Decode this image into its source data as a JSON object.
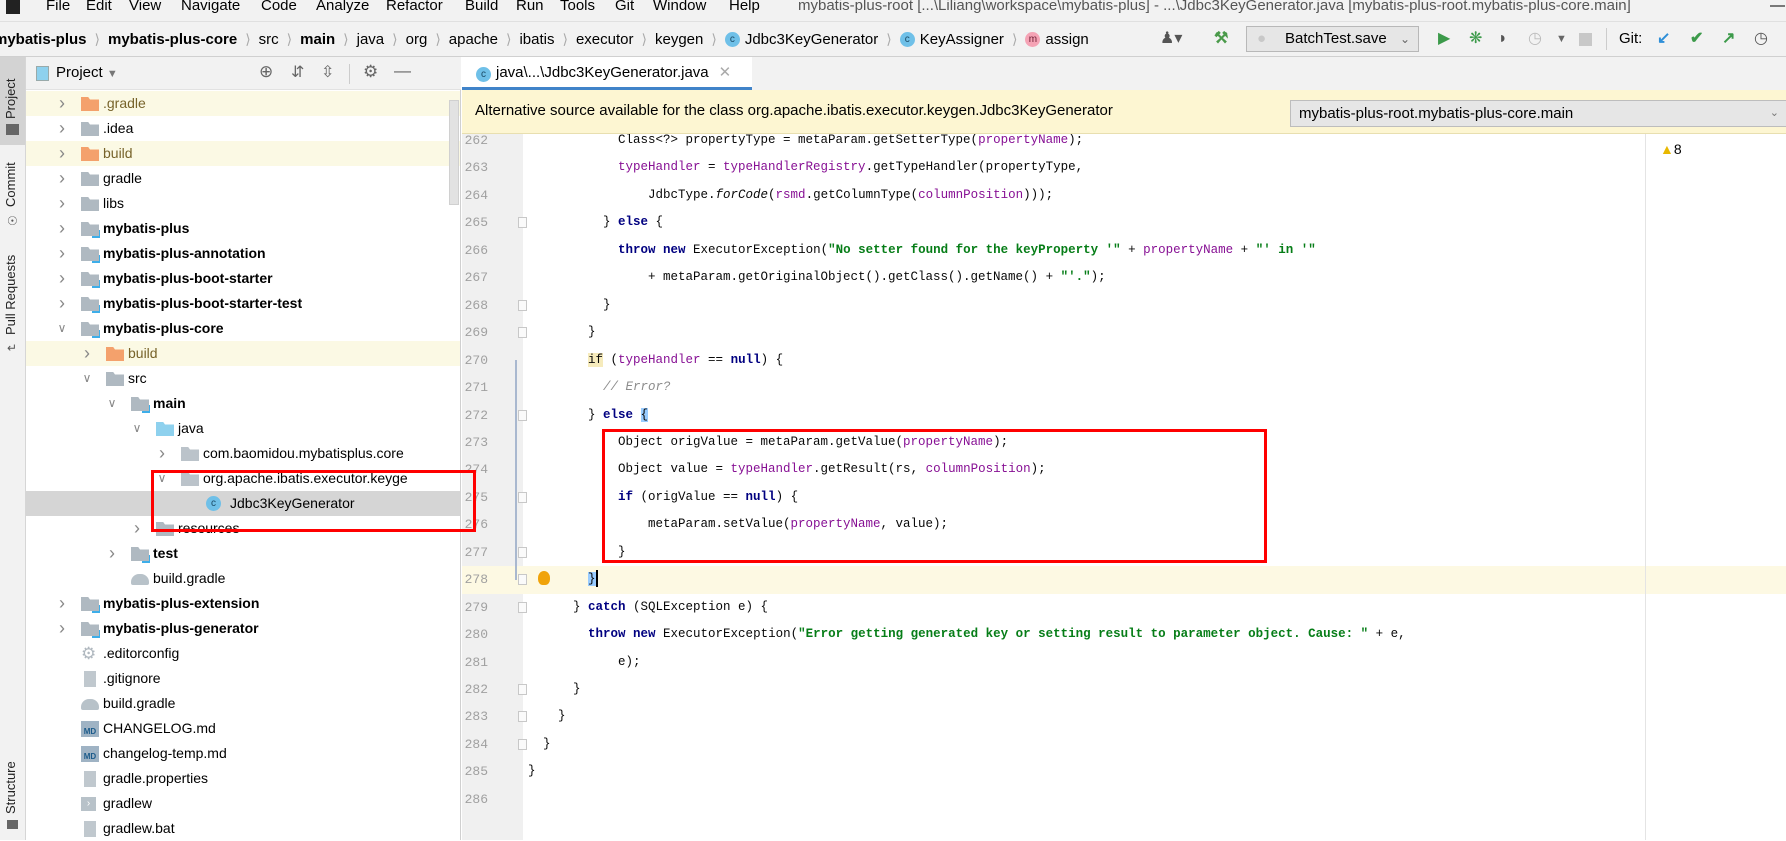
{
  "menu": {
    "items": [
      "File",
      "Edit",
      "View",
      "Navigate",
      "Code",
      "Analyze",
      "Refactor",
      "Build",
      "Run",
      "Tools",
      "Git",
      "Window",
      "Help"
    ],
    "window_title": "mybatis-plus-root [...\\Liliang\\workspace\\mybatis-plus] - ...\\Jdbc3KeyGenerator.java [mybatis-plus-root.mybatis-plus-core.main]",
    "minimize": "—"
  },
  "breadcrumb": [
    {
      "label": "mybatis-plus",
      "bold": true
    },
    {
      "label": "mybatis-plus-core",
      "bold": true
    },
    {
      "label": "src"
    },
    {
      "label": "main",
      "bold": true
    },
    {
      "label": "java"
    },
    {
      "label": "org"
    },
    {
      "label": "apache"
    },
    {
      "label": "ibatis"
    },
    {
      "label": "executor"
    },
    {
      "label": "keygen"
    },
    {
      "label": "Jdbc3KeyGenerator",
      "icon": "c"
    },
    {
      "label": "KeyAssigner",
      "icon": "c"
    },
    {
      "label": "assign",
      "icon": "m"
    }
  ],
  "toolbar": {
    "run_config": "BatchTest.save",
    "git_label": "Git:"
  },
  "side_stripe": {
    "project": "Project",
    "commit": "Commit",
    "pull_requests": "Pull Requests",
    "structure": "Structure"
  },
  "project_panel": {
    "title": "Project",
    "tree": [
      {
        "label": ".gradle",
        "depth": 0,
        "exp": "c",
        "icon": "f-orange",
        "hl": true
      },
      {
        "label": ".idea",
        "depth": 0,
        "exp": "c",
        "icon": "f-gray"
      },
      {
        "label": "build",
        "depth": 0,
        "exp": "c",
        "icon": "f-orange",
        "hl": true
      },
      {
        "label": "gradle",
        "depth": 0,
        "exp": "c",
        "icon": "f-gray"
      },
      {
        "label": "libs",
        "depth": 0,
        "exp": "c",
        "icon": "f-gray"
      },
      {
        "label": "mybatis-plus",
        "depth": 0,
        "exp": "c",
        "icon": "module",
        "bold": true
      },
      {
        "label": "mybatis-plus-annotation",
        "depth": 0,
        "exp": "c",
        "icon": "module",
        "bold": true
      },
      {
        "label": "mybatis-plus-boot-starter",
        "depth": 0,
        "exp": "c",
        "icon": "module",
        "bold": true
      },
      {
        "label": "mybatis-plus-boot-starter-test",
        "depth": 0,
        "exp": "c",
        "icon": "module",
        "bold": true
      },
      {
        "label": "mybatis-plus-core",
        "depth": 0,
        "exp": "e",
        "icon": "module",
        "bold": true
      },
      {
        "label": "build",
        "depth": 1,
        "exp": "c",
        "icon": "f-orange",
        "hl": true
      },
      {
        "label": "src",
        "depth": 1,
        "exp": "e",
        "icon": "f-gray"
      },
      {
        "label": "main",
        "depth": 2,
        "exp": "e",
        "icon": "module",
        "bold": true
      },
      {
        "label": "java",
        "depth": 3,
        "exp": "e",
        "icon": "f-blue"
      },
      {
        "label": "com.baomidou.mybatisplus.core",
        "depth": 4,
        "exp": "c",
        "icon": "package"
      },
      {
        "label": "org.apache.ibatis.executor.keyge",
        "depth": 4,
        "exp": "e",
        "icon": "package"
      },
      {
        "label": "Jdbc3KeyGenerator",
        "depth": 5,
        "exp": "n",
        "icon": "class",
        "selected": true
      },
      {
        "label": "resources",
        "depth": 3,
        "exp": "c",
        "icon": "f-gray"
      },
      {
        "label": "test",
        "depth": 2,
        "exp": "c",
        "icon": "module",
        "bold": true
      },
      {
        "label": "build.gradle",
        "depth": 2,
        "exp": "n",
        "icon": "gradle"
      },
      {
        "label": "mybatis-plus-extension",
        "depth": 0,
        "exp": "c",
        "icon": "module",
        "bold": true
      },
      {
        "label": "mybatis-plus-generator",
        "depth": 0,
        "exp": "c",
        "icon": "module",
        "bold": true
      },
      {
        "label": ".editorconfig",
        "depth": 0,
        "exp": "n",
        "icon": "gear"
      },
      {
        "label": ".gitignore",
        "depth": 0,
        "exp": "n",
        "icon": "file"
      },
      {
        "label": "build.gradle",
        "depth": 0,
        "exp": "n",
        "icon": "gradle"
      },
      {
        "label": "CHANGELOG.md",
        "depth": 0,
        "exp": "n",
        "icon": "md"
      },
      {
        "label": "changelog-temp.md",
        "depth": 0,
        "exp": "n",
        "icon": "md"
      },
      {
        "label": "gradle.properties",
        "depth": 0,
        "exp": "n",
        "icon": "file"
      },
      {
        "label": "gradlew",
        "depth": 0,
        "exp": "n",
        "icon": "terminal"
      },
      {
        "label": "gradlew.bat",
        "depth": 0,
        "exp": "n",
        "icon": "file"
      }
    ]
  },
  "editor": {
    "tab_label": "java\\...\\Jdbc3KeyGenerator.java",
    "notice": "Alternative source available for the class org.apache.ibatis.executor.keygen.Jdbc3KeyGenerator",
    "source_select": "mybatis-plus-root.mybatis-plus-core.main",
    "warning_count": "8",
    "current_line": 278,
    "lines": [
      {
        "n": 262,
        "indent": 12,
        "t": [
          [
            "p",
            "Class<?> propertyType = metaParam.getSetterType("
          ],
          [
            "f",
            "propertyName"
          ],
          [
            "p",
            ");"
          ]
        ]
      },
      {
        "n": 263,
        "indent": 12,
        "t": [
          [
            "f",
            "typeHandler"
          ],
          [
            "p",
            " = "
          ],
          [
            "f",
            "typeHandlerRegistry"
          ],
          [
            "p",
            ".getTypeHandler(propertyType,"
          ]
        ]
      },
      {
        "n": 264,
        "indent": 16,
        "t": [
          [
            "p",
            "JdbcType."
          ],
          [
            "i",
            "forCode"
          ],
          [
            "p",
            "("
          ],
          [
            "f",
            "rsmd"
          ],
          [
            "p",
            ".getColumnType("
          ],
          [
            "f",
            "columnPosition"
          ],
          [
            "p",
            ")));"
          ]
        ]
      },
      {
        "n": 265,
        "indent": 10,
        "fold": true,
        "t": [
          [
            "p",
            "} "
          ],
          [
            "k",
            "else"
          ],
          [
            "p",
            " {"
          ]
        ]
      },
      {
        "n": 266,
        "indent": 12,
        "t": [
          [
            "k",
            "throw"
          ],
          [
            "p",
            " "
          ],
          [
            "k",
            "new"
          ],
          [
            "p",
            " ExecutorException("
          ],
          [
            "s",
            "\"No setter found for the keyProperty '\""
          ],
          [
            "p",
            " + "
          ],
          [
            "f",
            "propertyName"
          ],
          [
            "p",
            " + "
          ],
          [
            "s",
            "\"' in '\""
          ]
        ]
      },
      {
        "n": 267,
        "indent": 16,
        "t": [
          [
            "p",
            "+ metaParam.getOriginalObject().getClass().getName() + "
          ],
          [
            "s",
            "\"'.\""
          ],
          [
            "p",
            ");"
          ]
        ]
      },
      {
        "n": 268,
        "indent": 10,
        "fold": true,
        "t": [
          [
            "p",
            "}"
          ]
        ]
      },
      {
        "n": 269,
        "indent": 8,
        "fold": true,
        "t": [
          [
            "p",
            "}"
          ]
        ]
      },
      {
        "n": 270,
        "indent": 8,
        "t": [
          [
            "hy",
            "if"
          ],
          [
            "p",
            " ("
          ],
          [
            "f",
            "typeHandler"
          ],
          [
            "p",
            " == "
          ],
          [
            "k",
            "null"
          ],
          [
            "p",
            ") {"
          ]
        ]
      },
      {
        "n": 271,
        "indent": 10,
        "t": [
          [
            "c",
            "// Error?"
          ]
        ]
      },
      {
        "n": 272,
        "indent": 8,
        "fold": true,
        "t": [
          [
            "p",
            "} "
          ],
          [
            "k",
            "else"
          ],
          [
            "p",
            " "
          ],
          [
            "hb",
            "{"
          ]
        ]
      },
      {
        "n": 273,
        "indent": 12,
        "t": [
          [
            "p",
            "Object origValue = metaParam.getValue("
          ],
          [
            "f",
            "propertyName"
          ],
          [
            "p",
            ");"
          ]
        ]
      },
      {
        "n": 274,
        "indent": 12,
        "t": [
          [
            "p",
            "Object value = "
          ],
          [
            "f",
            "typeHandler"
          ],
          [
            "p",
            ".getResult(rs, "
          ],
          [
            "f",
            "columnPosition"
          ],
          [
            "p",
            ");"
          ]
        ]
      },
      {
        "n": 275,
        "indent": 12,
        "fold": true,
        "t": [
          [
            "k",
            "if"
          ],
          [
            "p",
            " (origValue == "
          ],
          [
            "k",
            "null"
          ],
          [
            "p",
            ") {"
          ]
        ]
      },
      {
        "n": 276,
        "indent": 16,
        "t": [
          [
            "p",
            "metaParam.setValue("
          ],
          [
            "f",
            "propertyName"
          ],
          [
            "p",
            ", value);"
          ]
        ]
      },
      {
        "n": 277,
        "indent": 12,
        "fold": true,
        "t": [
          [
            "p",
            "}"
          ]
        ]
      },
      {
        "n": 278,
        "indent": 8,
        "fold": true,
        "bulb": true,
        "caret": true,
        "t": [
          [
            "hb",
            "}"
          ]
        ]
      },
      {
        "n": 279,
        "indent": 6,
        "fold": true,
        "t": [
          [
            "p",
            "} "
          ],
          [
            "k",
            "catch"
          ],
          [
            "p",
            " (SQLException e) {"
          ]
        ]
      },
      {
        "n": 280,
        "indent": 8,
        "t": [
          [
            "k",
            "throw"
          ],
          [
            "p",
            " "
          ],
          [
            "k",
            "new"
          ],
          [
            "p",
            " ExecutorException("
          ],
          [
            "s",
            "\"Error getting generated key or setting result to parameter object. Cause: \""
          ],
          [
            "p",
            " + e,"
          ]
        ]
      },
      {
        "n": 281,
        "indent": 12,
        "t": [
          [
            "p",
            "e);"
          ]
        ]
      },
      {
        "n": 282,
        "indent": 6,
        "fold": true,
        "t": [
          [
            "p",
            "}"
          ]
        ]
      },
      {
        "n": 283,
        "indent": 4,
        "fold": true,
        "t": [
          [
            "p",
            "}"
          ]
        ]
      },
      {
        "n": 284,
        "indent": 2,
        "fold": true,
        "t": [
          [
            "p",
            "}"
          ]
        ]
      },
      {
        "n": 285,
        "indent": 0,
        "t": [
          [
            "p",
            "}"
          ]
        ]
      },
      {
        "n": 286,
        "indent": 0,
        "t": []
      }
    ]
  }
}
